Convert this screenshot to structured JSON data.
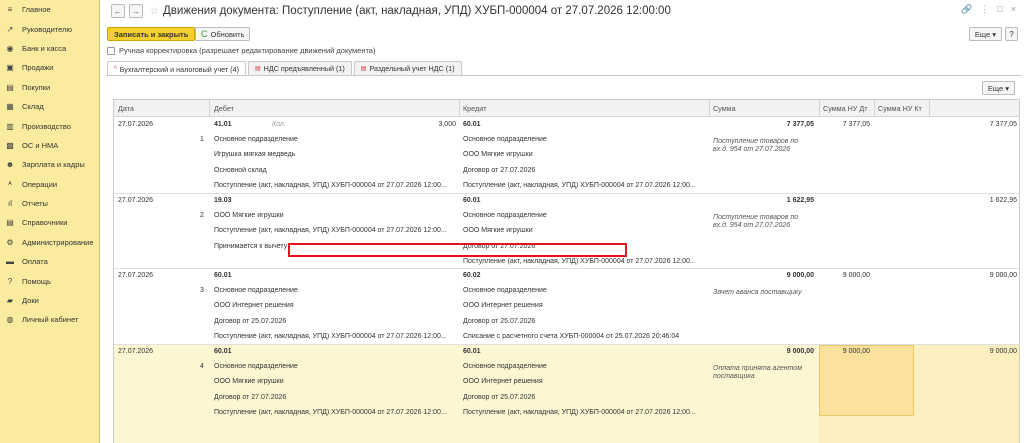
{
  "sidebar": {
    "items": [
      {
        "icon": "menu-icon",
        "glyph": "≡",
        "label": "Главное"
      },
      {
        "icon": "trend-icon",
        "glyph": "↗",
        "label": "Руководителю"
      },
      {
        "icon": "bank-icon",
        "glyph": "◉",
        "label": "Банк и касса"
      },
      {
        "icon": "cart-icon",
        "glyph": "▣",
        "label": "Продажи"
      },
      {
        "icon": "basket-icon",
        "glyph": "▤",
        "label": "Покупки"
      },
      {
        "icon": "warehouse-icon",
        "glyph": "▦",
        "label": "Склад"
      },
      {
        "icon": "factory-icon",
        "glyph": "▥",
        "label": "Производство"
      },
      {
        "icon": "assets-icon",
        "glyph": "▩",
        "label": "ОС и НМА"
      },
      {
        "icon": "people-icon",
        "glyph": "☻",
        "label": "Зарплата и кадры"
      },
      {
        "icon": "operations-icon",
        "glyph": "ᴬ",
        "label": "Операции"
      },
      {
        "icon": "reports-icon",
        "glyph": "ıl",
        "label": "Отчеты"
      },
      {
        "icon": "directory-icon",
        "glyph": "▤",
        "label": "Справочники"
      },
      {
        "icon": "gear-icon",
        "glyph": "⚙",
        "label": "Администрирование"
      },
      {
        "icon": "payment-icon",
        "glyph": "▬",
        "label": "Оплата"
      },
      {
        "icon": "help-icon",
        "glyph": "?",
        "label": "Помощь"
      },
      {
        "icon": "docs-icon",
        "glyph": "▰",
        "label": "Доки"
      },
      {
        "icon": "account-icon",
        "glyph": "◍",
        "label": "Личный кабинет"
      }
    ]
  },
  "header": {
    "back_glyph": "←",
    "forward_glyph": "→",
    "star_glyph": "☆",
    "title": "Движения документа: Поступление (акт, накладная, УПД) ХУБП-000004 от 27.07.2026 12:00:00",
    "link_glyph": "🔗",
    "menu_glyph": "⋮",
    "maximize_glyph": "□",
    "close_glyph": "×"
  },
  "toolbar": {
    "save_close_label": "Записать и закрыть",
    "refresh_glyph": "C",
    "refresh_label": "Обновить",
    "more_label": "Еще ▾",
    "help_label": "?"
  },
  "manual_correction": {
    "label": "Ручная корректировка (разрешает редактирование движений документа)",
    "checked": false
  },
  "tabs": [
    {
      "label": "Бухгалтерский и налоговый учет (4)",
      "glyph": "ᴬ",
      "active": true
    },
    {
      "label": "НДС предъявленный (1)",
      "glyph": "▤",
      "active": false
    },
    {
      "label": "Раздельный учет НДС (1)",
      "glyph": "▤",
      "active": false
    }
  ],
  "table_more_label": "Еще ▾",
  "table": {
    "columns": {
      "date": "Дата",
      "debit": "Дебет",
      "credit": "Кредит",
      "sum": "Сумма",
      "sum_nu_dt": "Сумма НУ Дт",
      "sum_nu_kt": "Сумма НУ Кт"
    },
    "entries": [
      {
        "date": "27.07.2026",
        "n": "1",
        "debit_account": "41.01",
        "kol_label": "Кол.",
        "kol_value": "3,000",
        "debit_sub": [
          "Основное подразделение",
          "Игрушка мягкая медведь",
          "Основной склад",
          "Поступление (акт, накладная, УПД) ХУБП-000004 от 27.07.2026 12:00..."
        ],
        "credit_account": "60.01",
        "credit_sub": [
          "Основное подразделение",
          "ООО Мягкие игрушки",
          "Договор от 27.07.2026",
          "Поступление (акт, накладная, УПД) ХУБП-000004 от 27.07.2026 12:00..."
        ],
        "sum": "7 377,05",
        "content": "Поступление товаров по вх.д. 954 от 27.07.2026",
        "nu_dt": "7 377,05",
        "nu_kt": "7 377,05"
      },
      {
        "date": "27.07.2026",
        "n": "2",
        "debit_account": "19.03",
        "kol_label": "",
        "kol_value": "",
        "debit_sub": [
          "ООО Мягкие игрушки",
          "Поступление (акт, накладная, УПД) ХУБП-000004 от 27.07.2026 12:00...",
          "Принимается к вычету"
        ],
        "credit_account": "60.01",
        "credit_sub": [
          "Основное подразделение",
          "ООО Мягкие игрушки",
          "Договор от 27.07.2026",
          "Поступление (акт, накладная, УПД) ХУБП-000004 от 27.07.2026 12:00..."
        ],
        "sum": "1 622,95",
        "content": "Поступление товаров по вх.д. 954 от 27.07.2026",
        "nu_dt": "",
        "nu_kt": "1 622,95"
      },
      {
        "date": "27.07.2026",
        "n": "3",
        "debit_account": "60.01",
        "kol_label": "",
        "kol_value": "",
        "debit_sub": [
          "Основное подразделение",
          "ООО Интернет решения",
          "Договор от 25.07.2026",
          "Поступление (акт, накладная, УПД) ХУБП-000004 от 27.07.2026 12:00..."
        ],
        "credit_account": "60.02",
        "credit_sub": [
          "Основное подразделение",
          "ООО Интернет решения",
          "Договор от 25.07.2026",
          "Списание с расчетного счета ХУБП-000004 от 25.07.2026 20:46:04"
        ],
        "sum": "9 000,00",
        "content": "Зачет аванса поставщику",
        "nu_dt": "9 000,00",
        "nu_kt": "9 000,00"
      },
      {
        "date": "27.07.2026",
        "n": "4",
        "debit_account": "60.01",
        "kol_label": "",
        "kol_value": "",
        "debit_sub": [
          "Основное подразделение",
          "ООО Мягкие игрушки",
          "Договор от 27.07.2026",
          "Поступление (акт, накладная, УПД) ХУБП-000004 от 27.07.2026 12:00..."
        ],
        "credit_account": "60.01",
        "credit_sub": [
          "Основное подразделение",
          "ООО Интернет решения",
          "Договор от 25.07.2026",
          "Поступление (акт, накладная, УПД) ХУБП-000004 от 27.07.2026 12:00..."
        ],
        "sum": "9 000,00",
        "content": "Оплата принята агентом поставщика",
        "nu_dt": "9 000,00",
        "nu_kt": "9 000,00"
      }
    ]
  },
  "colors": {
    "sidebar": "#fbeb9e",
    "accent": "#f5d02c",
    "selected_row": "#fdf6d3",
    "highlight": "#e0151f"
  }
}
